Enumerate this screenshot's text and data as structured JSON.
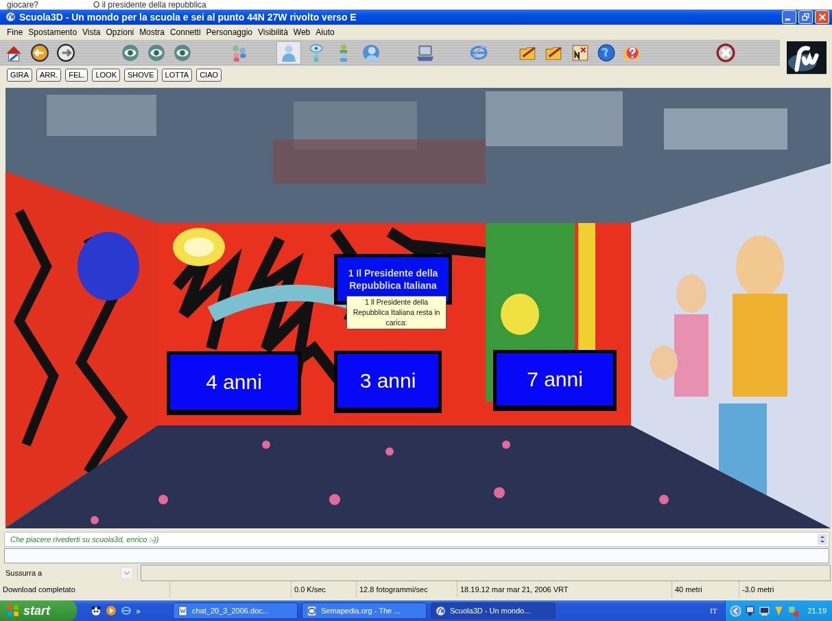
{
  "document_strip": {
    "texts": [
      "giocare?",
      "O il presidente della repubblica"
    ]
  },
  "window": {
    "title": "Scuola3D - Un mondo per la scuola e sei al punto 44N 27W rivolto verso E"
  },
  "menu": [
    "Fine",
    "Spostamento",
    "Vista",
    "Opzioni",
    "Mostra",
    "Connetti",
    "Personaggio",
    "Visibilità",
    "Web",
    "Aiuto"
  ],
  "toolbar": [
    [
      {
        "kind": "home",
        "selected": false
      },
      {
        "kind": "back",
        "selected": false
      },
      {
        "kind": "forward",
        "selected": false
      }
    ],
    [
      {
        "kind": "eye",
        "selected": false
      },
      {
        "kind": "eye",
        "selected": false
      },
      {
        "kind": "eye",
        "selected": false
      }
    ],
    [
      {
        "kind": "people",
        "selected": false
      }
    ],
    [
      {
        "kind": "person",
        "selected": true
      },
      {
        "kind": "eye-person",
        "selected": false
      },
      {
        "kind": "persons",
        "selected": false
      },
      {
        "kind": "person-globe",
        "selected": false
      }
    ],
    [
      {
        "kind": "laptop",
        "selected": false
      }
    ],
    [
      {
        "kind": "browser",
        "selected": false
      }
    ],
    [
      {
        "kind": "folder",
        "selected": false
      },
      {
        "kind": "folder",
        "selected": false
      },
      {
        "kind": "map",
        "selected": false
      },
      {
        "kind": "globe",
        "selected": false
      },
      {
        "kind": "help",
        "selected": false
      }
    ],
    [
      {
        "kind": "stop",
        "selected": false
      }
    ]
  ],
  "action_buttons": [
    "GIRA",
    "ARR.",
    "FEL.",
    "LOOK",
    "SHOVE",
    "LOTTA",
    "CIAO"
  ],
  "scene": {
    "question": "1 Il Presidente della Repubblica Italiana",
    "tooltip": "1 Il Presidente della Repubblica Italiana resta in carica:",
    "answers": [
      "4 anni",
      "3 anni",
      "7 anni"
    ]
  },
  "chat": {
    "message": "Che piacere rivederti su scuola3d, enrico :-))"
  },
  "whisper": {
    "label": "Sussurra a"
  },
  "status_bar": [
    "Download completato",
    "0.0 K/sec",
    "12.8 fotogrammi/sec",
    "18.19.12 mar mar 21, 2006 VRT",
    "40 metri",
    "-3.0 metri"
  ],
  "taskbar": {
    "start": "start",
    "overflow": "»",
    "tasks": [
      {
        "label": "chat_20_3_2006.doc...",
        "kind": "document",
        "selected": false
      },
      {
        "label": "Semapedia.org - The ...",
        "kind": "browser",
        "selected": false
      },
      {
        "label": "Scuola3D - Un mondo...",
        "kind": "app",
        "selected": true
      }
    ],
    "language": "IT",
    "clock": "21.19"
  }
}
